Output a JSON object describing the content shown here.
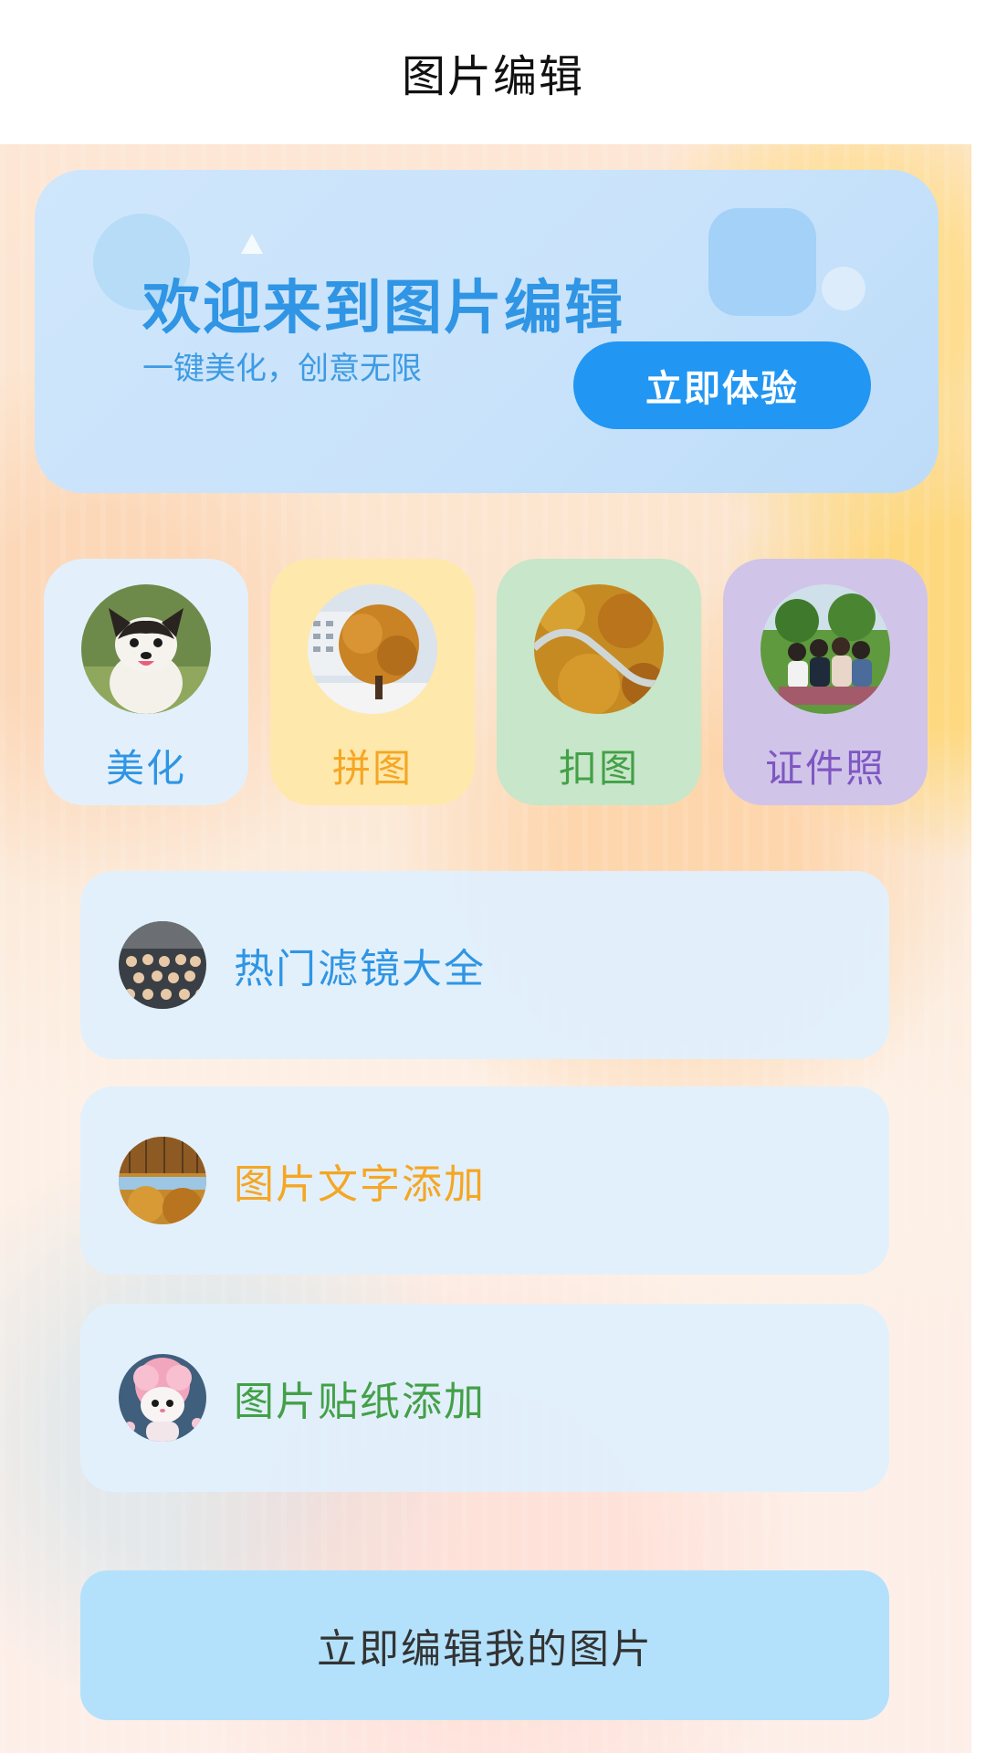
{
  "header": {
    "title": "图片编辑"
  },
  "banner": {
    "title": "欢迎来到图片编辑",
    "subtitle": "一键美化，创意无限",
    "button_label": "立即体验"
  },
  "features": [
    {
      "label": "美化",
      "color": "#2f95e4",
      "bg": "#e3f0fb"
    },
    {
      "label": "拼图",
      "color": "#f5a623",
      "bg": "#ffe8ab"
    },
    {
      "label": "扣图",
      "color": "#43a047",
      "bg": "#c8e6c9"
    },
    {
      "label": "证件照",
      "color": "#7e57c2",
      "bg": "#d1c4e9"
    }
  ],
  "list": [
    {
      "label": "热门滤镜大全",
      "color": "#2f95e4"
    },
    {
      "label": "图片文字添加",
      "color": "#f5a623"
    },
    {
      "label": "图片贴纸添加",
      "color": "#43a047"
    }
  ],
  "cta": {
    "label": "立即编辑我的图片"
  }
}
